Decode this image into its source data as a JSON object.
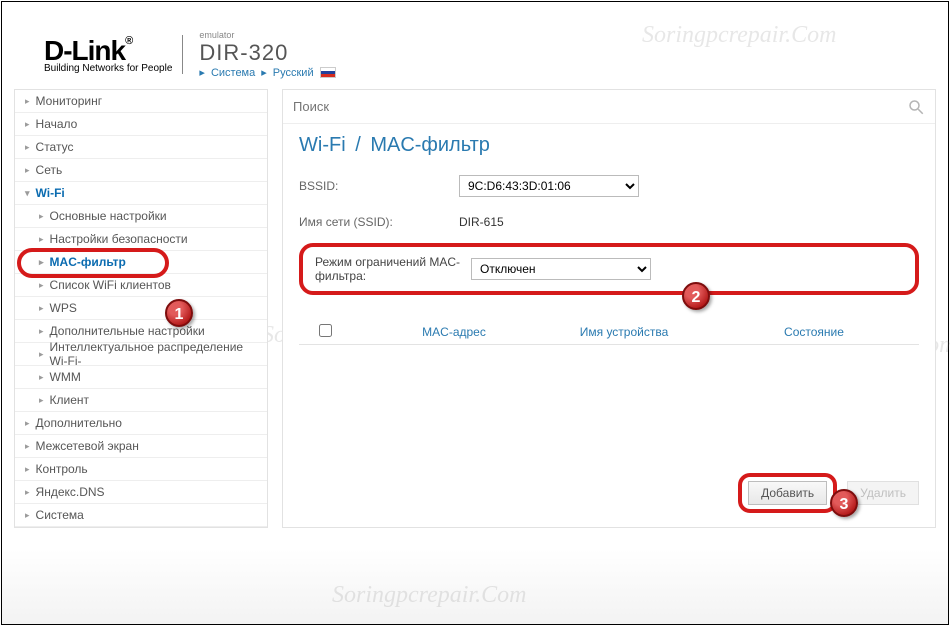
{
  "brand": {
    "name": "D-Link",
    "tagline": "Building Networks for People",
    "superscript": "emulator",
    "model": "DIR-320"
  },
  "breadcrumb": {
    "item1": "Система",
    "item2": "Русский"
  },
  "sidebar": {
    "monitoring": "Мониторинг",
    "start": "Начало",
    "status": "Статус",
    "network": "Сеть",
    "wifi": "Wi-Fi",
    "wifi_basic": "Основные настройки",
    "wifi_security": "Настройки безопасности",
    "wifi_mac": "MAC-фильтр",
    "wifi_clients": "Список WiFi клиентов",
    "wifi_wps": "WPS",
    "wifi_adv": "Дополнительные настройки",
    "wifi_intel": "Интеллектуальное распределение Wi-Fi-",
    "wifi_wmm": "WMM",
    "wifi_client": "Клиент",
    "extra": "Дополнительно",
    "firewall": "Межсетевой экран",
    "control": "Контроль",
    "yandex": "Яндекс.DNS",
    "system": "Система"
  },
  "search": {
    "placeholder": "Поиск"
  },
  "page": {
    "breadcrumb_root": "Wi-Fi",
    "title": "MAC-фильтр",
    "sep": "/"
  },
  "fields": {
    "bssid_label": "BSSID:",
    "bssid_value": "9C:D6:43:3D:01:06",
    "ssid_label": "Имя сети (SSID):",
    "ssid_value": "DIR-615",
    "mode_label": "Режим ограничений MAC-фильтра:",
    "mode_value": "Отключен"
  },
  "table": {
    "col_mac": "MAC-адрес",
    "col_name": "Имя устройства",
    "col_state": "Состояние"
  },
  "buttons": {
    "add": "Добавить",
    "delete": "Удалить"
  },
  "callouts": {
    "c1": "1",
    "c2": "2",
    "c3": "3"
  },
  "watermark": "Soringpcrepair.Com"
}
